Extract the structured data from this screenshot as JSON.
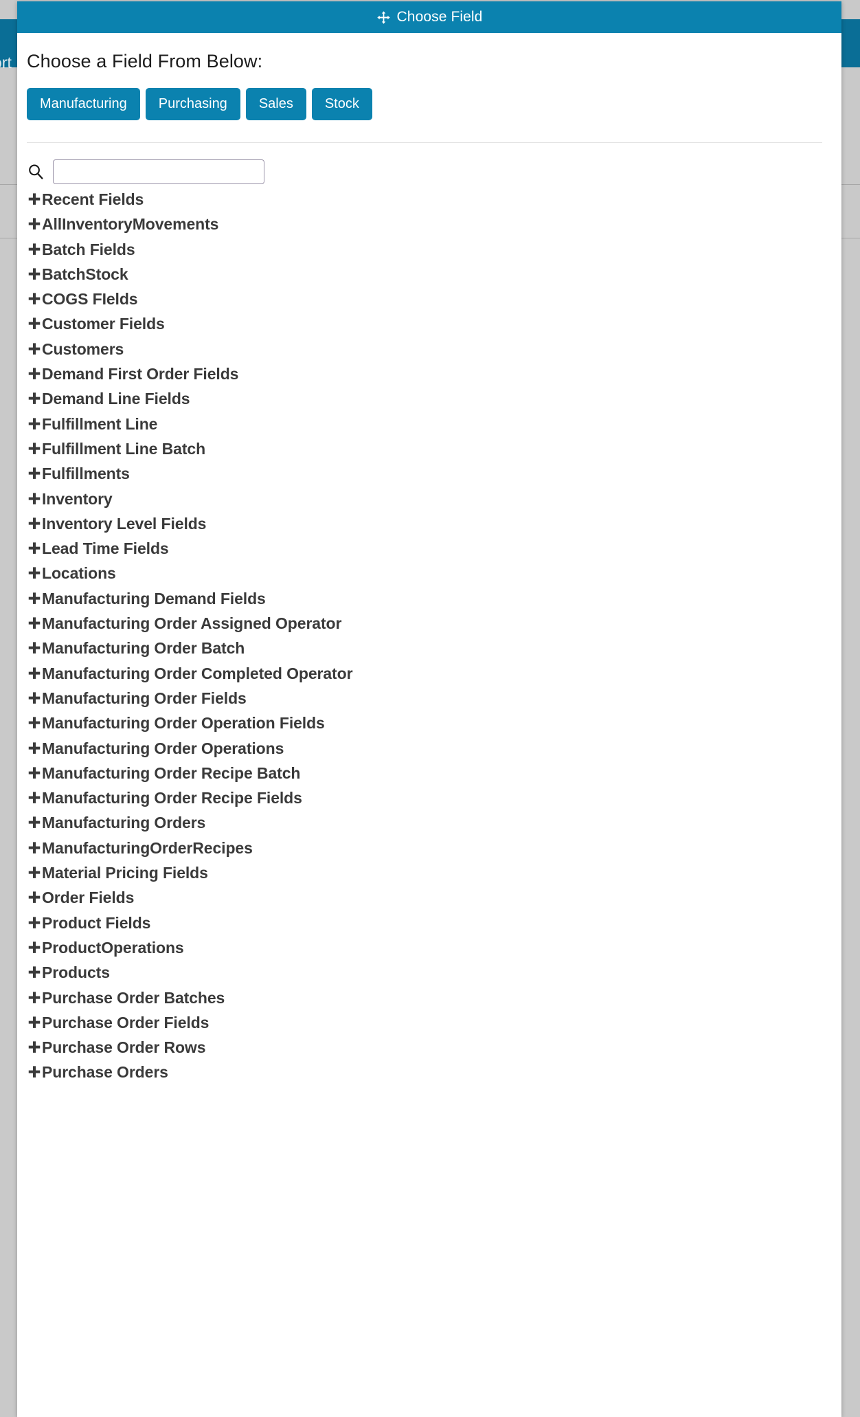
{
  "backdrop": {
    "navbar_partial_text": "ort"
  },
  "modal": {
    "title": "Choose Field",
    "move_icon": "move-arrows-icon",
    "heading": "Choose a Field From Below:",
    "category_buttons": [
      {
        "label": "Manufacturing"
      },
      {
        "label": "Purchasing"
      },
      {
        "label": "Sales"
      },
      {
        "label": "Stock"
      }
    ],
    "search": {
      "icon": "search-icon",
      "value": "",
      "placeholder": ""
    },
    "expand_icon": "plus-icon",
    "field_groups": [
      {
        "label": "Recent Fields"
      },
      {
        "label": "AllInventoryMovements"
      },
      {
        "label": "Batch Fields"
      },
      {
        "label": "BatchStock"
      },
      {
        "label": "COGS FIelds"
      },
      {
        "label": "Customer Fields"
      },
      {
        "label": "Customers"
      },
      {
        "label": "Demand First Order Fields"
      },
      {
        "label": "Demand Line Fields"
      },
      {
        "label": "Fulfillment Line"
      },
      {
        "label": "Fulfillment Line Batch"
      },
      {
        "label": "Fulfillments"
      },
      {
        "label": "Inventory"
      },
      {
        "label": "Inventory Level Fields"
      },
      {
        "label": "Lead Time Fields"
      },
      {
        "label": "Locations"
      },
      {
        "label": "Manufacturing Demand Fields"
      },
      {
        "label": "Manufacturing Order Assigned Operator"
      },
      {
        "label": "Manufacturing Order Batch"
      },
      {
        "label": "Manufacturing Order Completed Operator"
      },
      {
        "label": "Manufacturing Order Fields"
      },
      {
        "label": "Manufacturing Order Operation Fields"
      },
      {
        "label": "Manufacturing Order Operations"
      },
      {
        "label": "Manufacturing Order Recipe Batch"
      },
      {
        "label": "Manufacturing Order Recipe Fields"
      },
      {
        "label": "Manufacturing Orders"
      },
      {
        "label": "ManufacturingOrderRecipes"
      },
      {
        "label": "Material Pricing Fields"
      },
      {
        "label": "Order Fields"
      },
      {
        "label": "Product Fields"
      },
      {
        "label": "ProductOperations"
      },
      {
        "label": "Products"
      },
      {
        "label": "Purchase Order Batches"
      },
      {
        "label": "Purchase Order Fields"
      },
      {
        "label": "Purchase Order Rows"
      },
      {
        "label": "Purchase Orders"
      }
    ]
  },
  "colors": {
    "accent_blue": "#0b82af",
    "navbar_blue": "#0a6e96",
    "backdrop_gray": "#c9c9c9",
    "text_dark": "#3a3a3a"
  }
}
